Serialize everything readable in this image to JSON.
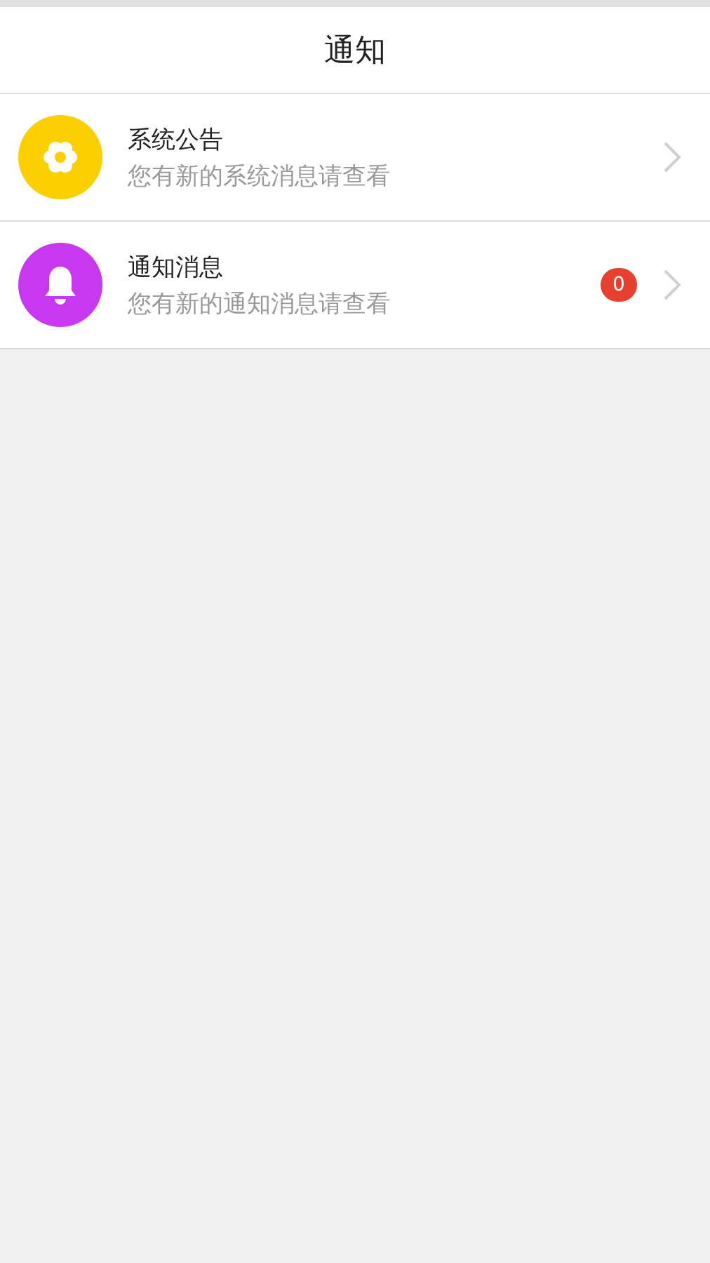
{
  "header": {
    "title": "通知"
  },
  "items": [
    {
      "kind": "gear",
      "color": "#fcd000",
      "title": "系统公告",
      "subtitle": "您有新的系统消息请查看"
    },
    {
      "kind": "bell",
      "color": "#c738f0",
      "title": "通知消息",
      "subtitle": "您有新的通知消息请查看",
      "badge": "0"
    }
  ]
}
